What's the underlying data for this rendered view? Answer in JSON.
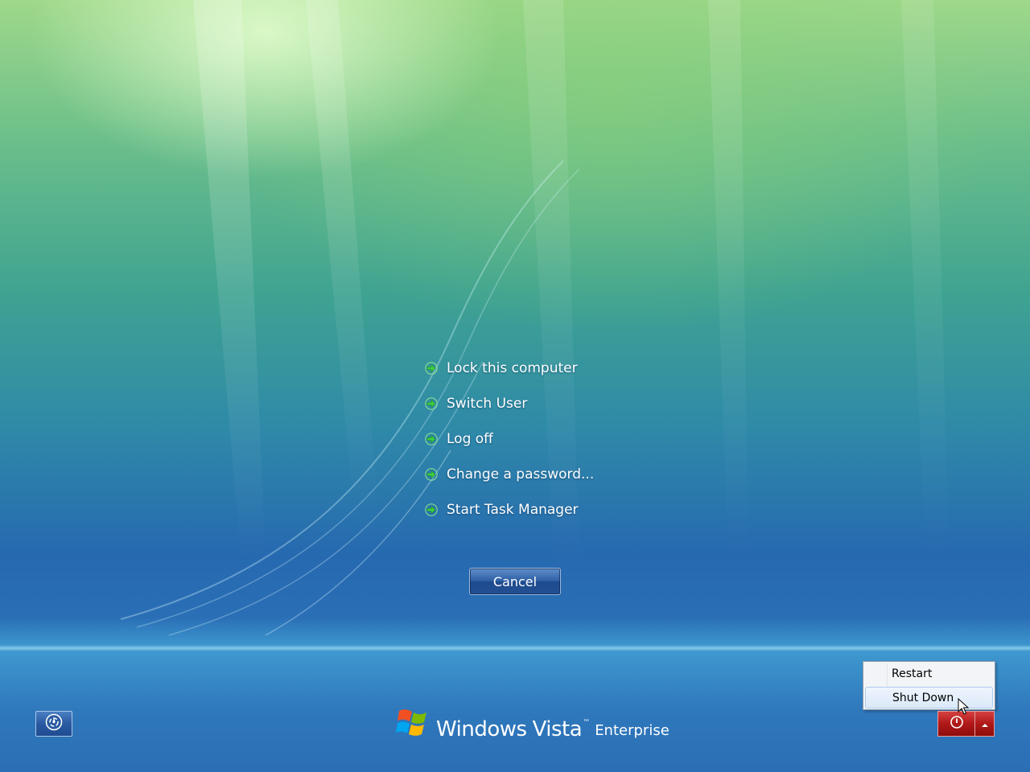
{
  "background": {
    "description_colors": [
      "#9fd88a",
      "#3fa391",
      "#2669b0"
    ]
  },
  "options": [
    {
      "label": "Lock this computer",
      "icon": "green-arrow-icon"
    },
    {
      "label": "Switch User",
      "icon": "green-arrow-icon"
    },
    {
      "label": "Log off",
      "icon": "green-arrow-icon"
    },
    {
      "label": "Change a password...",
      "icon": "green-arrow-icon"
    },
    {
      "label": "Start Task Manager",
      "icon": "green-arrow-icon"
    }
  ],
  "cancel_label": "Cancel",
  "branding": {
    "windows": "Windows",
    "vista": "Vista",
    "trademark": "™",
    "edition": "Enterprise"
  },
  "power_menu": {
    "items": [
      {
        "label": "Restart",
        "highlighted": false
      },
      {
        "label": "Shut Down",
        "highlighted": true
      }
    ]
  },
  "icons": {
    "ease_of_access": "ease-of-access-icon",
    "power": "power-icon",
    "menu_arrow": "chevron-up-icon",
    "windows_logo": "windows-flag-icon"
  },
  "colors": {
    "option_arrow": "#3fcf3f",
    "power_button": "#b01818",
    "cancel_button": "#2f5fa5"
  }
}
